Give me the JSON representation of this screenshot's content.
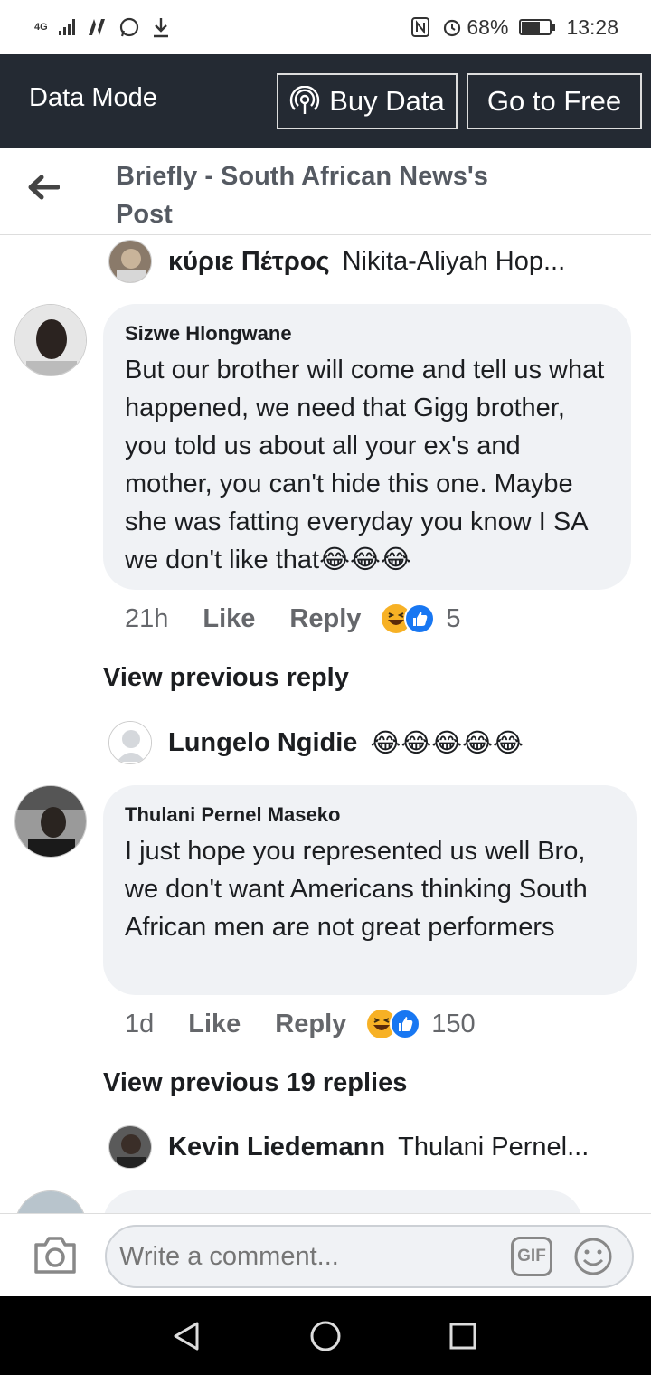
{
  "status_bar": {
    "network": "4G",
    "battery_percent": "68%",
    "battery_level": 0.68,
    "time": "13:28"
  },
  "data_bar": {
    "title": "Data Mode",
    "buy_data_label": "Buy Data",
    "go_free_label": "Go to Free"
  },
  "header": {
    "title": "Briefly - South African News's Post"
  },
  "comments": [
    {
      "reply_preview": {
        "name": "κύριε Πέτρος",
        "text": "Nikita-Aliyah Hop..."
      },
      "author": "Sizwe Hlongwane",
      "body": "But our brother will come and tell us what happened, we need that Gigg brother, you told us about all your ex's and mother, you can't hide this one. Maybe she was fatting everyday you know I SA we don't like that😂😂😂",
      "time": "21h",
      "like_label": "Like",
      "reply_label": "Reply",
      "reaction_count": "5"
    },
    {
      "view_previous": "View previous reply",
      "reply_preview": {
        "name": "Lungelo Ngidie",
        "text": "😂😂😂😂😂"
      },
      "author": "Thulani Pernel Maseko",
      "body": "I just hope you represented us well Bro, we don't want Americans thinking South African men are not great performers",
      "time": "1d",
      "like_label": "Like",
      "reply_label": "Reply",
      "reaction_count": "150"
    },
    {
      "view_previous": "View previous 19 replies",
      "reply_preview": {
        "name": "Kevin Liedemann",
        "text": "Thulani Pernel..."
      }
    }
  ],
  "composer": {
    "placeholder": "Write a comment...",
    "gif_label": "GIF"
  },
  "icons": [
    "camera-icon",
    "smiley-icon",
    "back-arrow-icon",
    "broadcast-icon"
  ],
  "colors": {
    "data_bar_bg": "#242a33",
    "bubble_bg": "#f0f2f5",
    "like_blue": "#1877f2",
    "laugh_yellow": "#f7b125"
  }
}
